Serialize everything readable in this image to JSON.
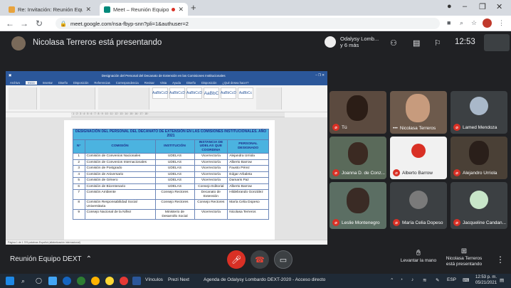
{
  "browser": {
    "tabs": [
      {
        "label": "Re: Invitación: Reunión Equipo D",
        "icon_color": "#e8a33d"
      },
      {
        "label": "Meet – Reunión Equipo DEXT",
        "icon_color": "#00897b"
      }
    ],
    "new_tab": "+",
    "url": "meet.google.com/nsa-fbyp-snn?pli=1&authuser=2",
    "window_controls": [
      "–",
      "❐",
      "✕"
    ]
  },
  "meet": {
    "presenting_text": "Nicolasa Terreros está presentando",
    "joined_name": "Odalysy Lomb...",
    "joined_more": "y 6 más",
    "time": "12:53",
    "meeting_name": "Reunión Equipo DEXT",
    "raise_hand": "Levantar la mano",
    "presenter_label": "Nicolasa Terreros está presentando"
  },
  "document": {
    "title_bar": "Designación del Personal del Decanato de Extensión en las Comisiones Institucionales",
    "menu": [
      "Archivo",
      "Inicio",
      "Insertar",
      "Diseño",
      "Disposición",
      "Referencias",
      "Correspondencia",
      "Revisar",
      "Vista",
      "Ayuda",
      "Diseño",
      "Disposición",
      "¿Qué desea hacer?"
    ],
    "ruler": "· 1 · 2 · 3 · 4 · 5 · 6 · 7 · 8 · 9 · 10 · 11 · 12 · 13 · 14 · 15 · 16 · 17 · 18 ·",
    "status": "Página 1 de 1    376 palabras    Español (alfabetización internacional)",
    "styles": [
      "AaBbCcD",
      "AaBbCcD",
      "AaBbCcD",
      "AaBbC",
      "AaBbCcD",
      "AaBbCc"
    ],
    "table": {
      "title": "DESIGNACIÓN DEL PERSONAL DEL DECANATO DE EXTENSIÓN EN LAS COMISIONES INSTITUCIONALES. AÑO 2021",
      "headers": [
        "N°",
        "COMISIÓN",
        "INSTITUCIÓN",
        "INSTANCIA DE UDELAS QUE COORDINA",
        "PERSONAL DESIGNADO"
      ],
      "rows": [
        [
          "1",
          "Comisión de Convenios Nacionales",
          "UDELAS",
          "Vicerrectoría",
          "Alejandra Urriola"
        ],
        [
          "2",
          "Comisión de Convenios Internacionales",
          "UDELAS",
          "Vicerrectoría",
          "Alberto Barrow"
        ],
        [
          "3",
          "Comisión de Postgrado",
          "UDELAS",
          "Vicerrectoría",
          "Fausto Pérez"
        ],
        [
          "4",
          "Comisión de Aniversario",
          "UDELAS",
          "Vicerrectoría",
          "Edgar Arbaleta"
        ],
        [
          "5",
          "Comisión de Género",
          "UDELAS",
          "Vicerrectoría",
          "Damaris Paz"
        ],
        [
          "6",
          "Comisión de Bicentenario",
          "UDELAS",
          "Consejo Editorial",
          "Alberto Barrow"
        ],
        [
          "7",
          "Comisión Ambiente",
          "Consejo Rectores",
          "Decanato de Extensión",
          "Hildebrando González"
        ],
        [
          "8",
          "Comisión Responsabilidad Social Universitaria",
          "Consejo Rectores",
          "Consejo Rectores",
          "María Celia Dopeso"
        ],
        [
          "9",
          "Consejo Nacional de la Niñez",
          "Ministerio de Desarrollo Social",
          "Vicerrectoría",
          "Nicolasa Terreros"
        ]
      ]
    }
  },
  "participants": [
    {
      "name": "Tú",
      "bg": "#5b4a3f"
    },
    {
      "name": "Nicolasa Terreros",
      "bg": "#6d5a4c"
    },
    {
      "name": "Lamed Mendoza",
      "bg": "#3c4043",
      "avatar": "#a9b8c9"
    },
    {
      "name": "Joanna D. de Conz...",
      "bg": "#5a6a5a"
    },
    {
      "name": "Alberto Barrow",
      "bg": "#f1f1f1",
      "avatar": "#d93025"
    },
    {
      "name": "Alejandro Urriola",
      "bg": "#4a4036"
    },
    {
      "name": "Leslie Montenegro",
      "bg": "#5b6e63"
    },
    {
      "name": "María Celia Dopeso",
      "bg": "#3c4043",
      "avatar": "#7a7a7a"
    },
    {
      "name": "Jacqueline Candan...",
      "bg": "#3c4043",
      "avatar": "#c8e6c9"
    }
  ],
  "taskbar": {
    "items": [
      "Vínculos",
      "Prezi Next",
      "Agenda de Odalysy Lombardo DEXT-2020 - Acceso directo"
    ],
    "lang": "ESP",
    "time": "12:53 p. m.",
    "date": "05/21/2021"
  },
  "colors": {
    "meet_bg": "#202124",
    "word_blue": "#2b579a",
    "table_header": "#4bb3e0",
    "mic_off": "#d93025"
  }
}
